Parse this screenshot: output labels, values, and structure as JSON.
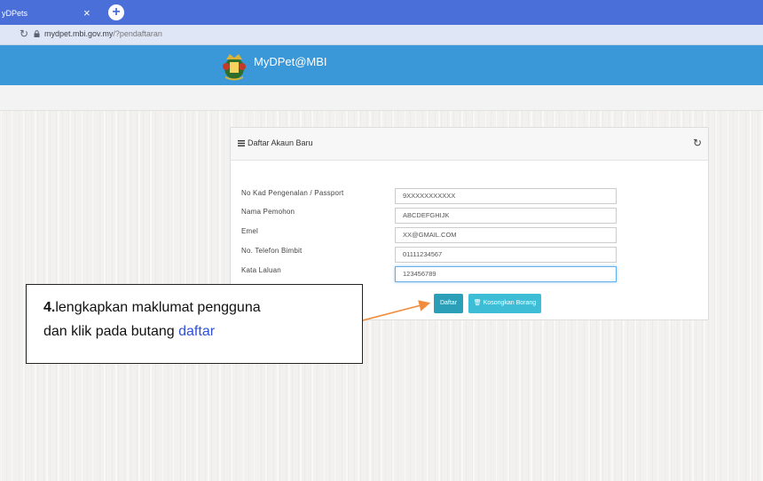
{
  "browser": {
    "tab_title": "yDPets",
    "tab_close": "×",
    "new_tab": "+",
    "url_host": "mydpet.mbi.gov.my",
    "url_path": "/?pendaftaran"
  },
  "site": {
    "title": "MyDPet@MBI",
    "crest_icon": "crest-logo"
  },
  "panel": {
    "title": "Daftar Akaun Baru",
    "fields": [
      {
        "label": "No Kad Pengenalan / Passport",
        "value": "9XXXXXXXXXXX"
      },
      {
        "label": "Nama Pemohon",
        "value": "ABCDEFGHIJK"
      },
      {
        "label": "Emel",
        "value": "XX@GMAIL.COM"
      },
      {
        "label": "No. Telefon Bimbit",
        "value": "01111234567"
      },
      {
        "label": "Kata Laluan",
        "value": "123456789"
      }
    ],
    "submit_label": "Daftar",
    "clear_label": "Kosongkan Borang"
  },
  "annotation": {
    "step": "4.",
    "line1": "lengkapkan maklumat pengguna",
    "line2_prefix": "dan klik pada butang ",
    "line2_highlight": "daftar"
  },
  "colors": {
    "header_blue": "#3a97d8",
    "tab_blue": "#4a6fd8",
    "submit_button": "#2a9fb7",
    "clear_button": "#3dbdd6",
    "arrow_orange": "#f08c3a",
    "highlight_text": "#2f4fd8"
  }
}
